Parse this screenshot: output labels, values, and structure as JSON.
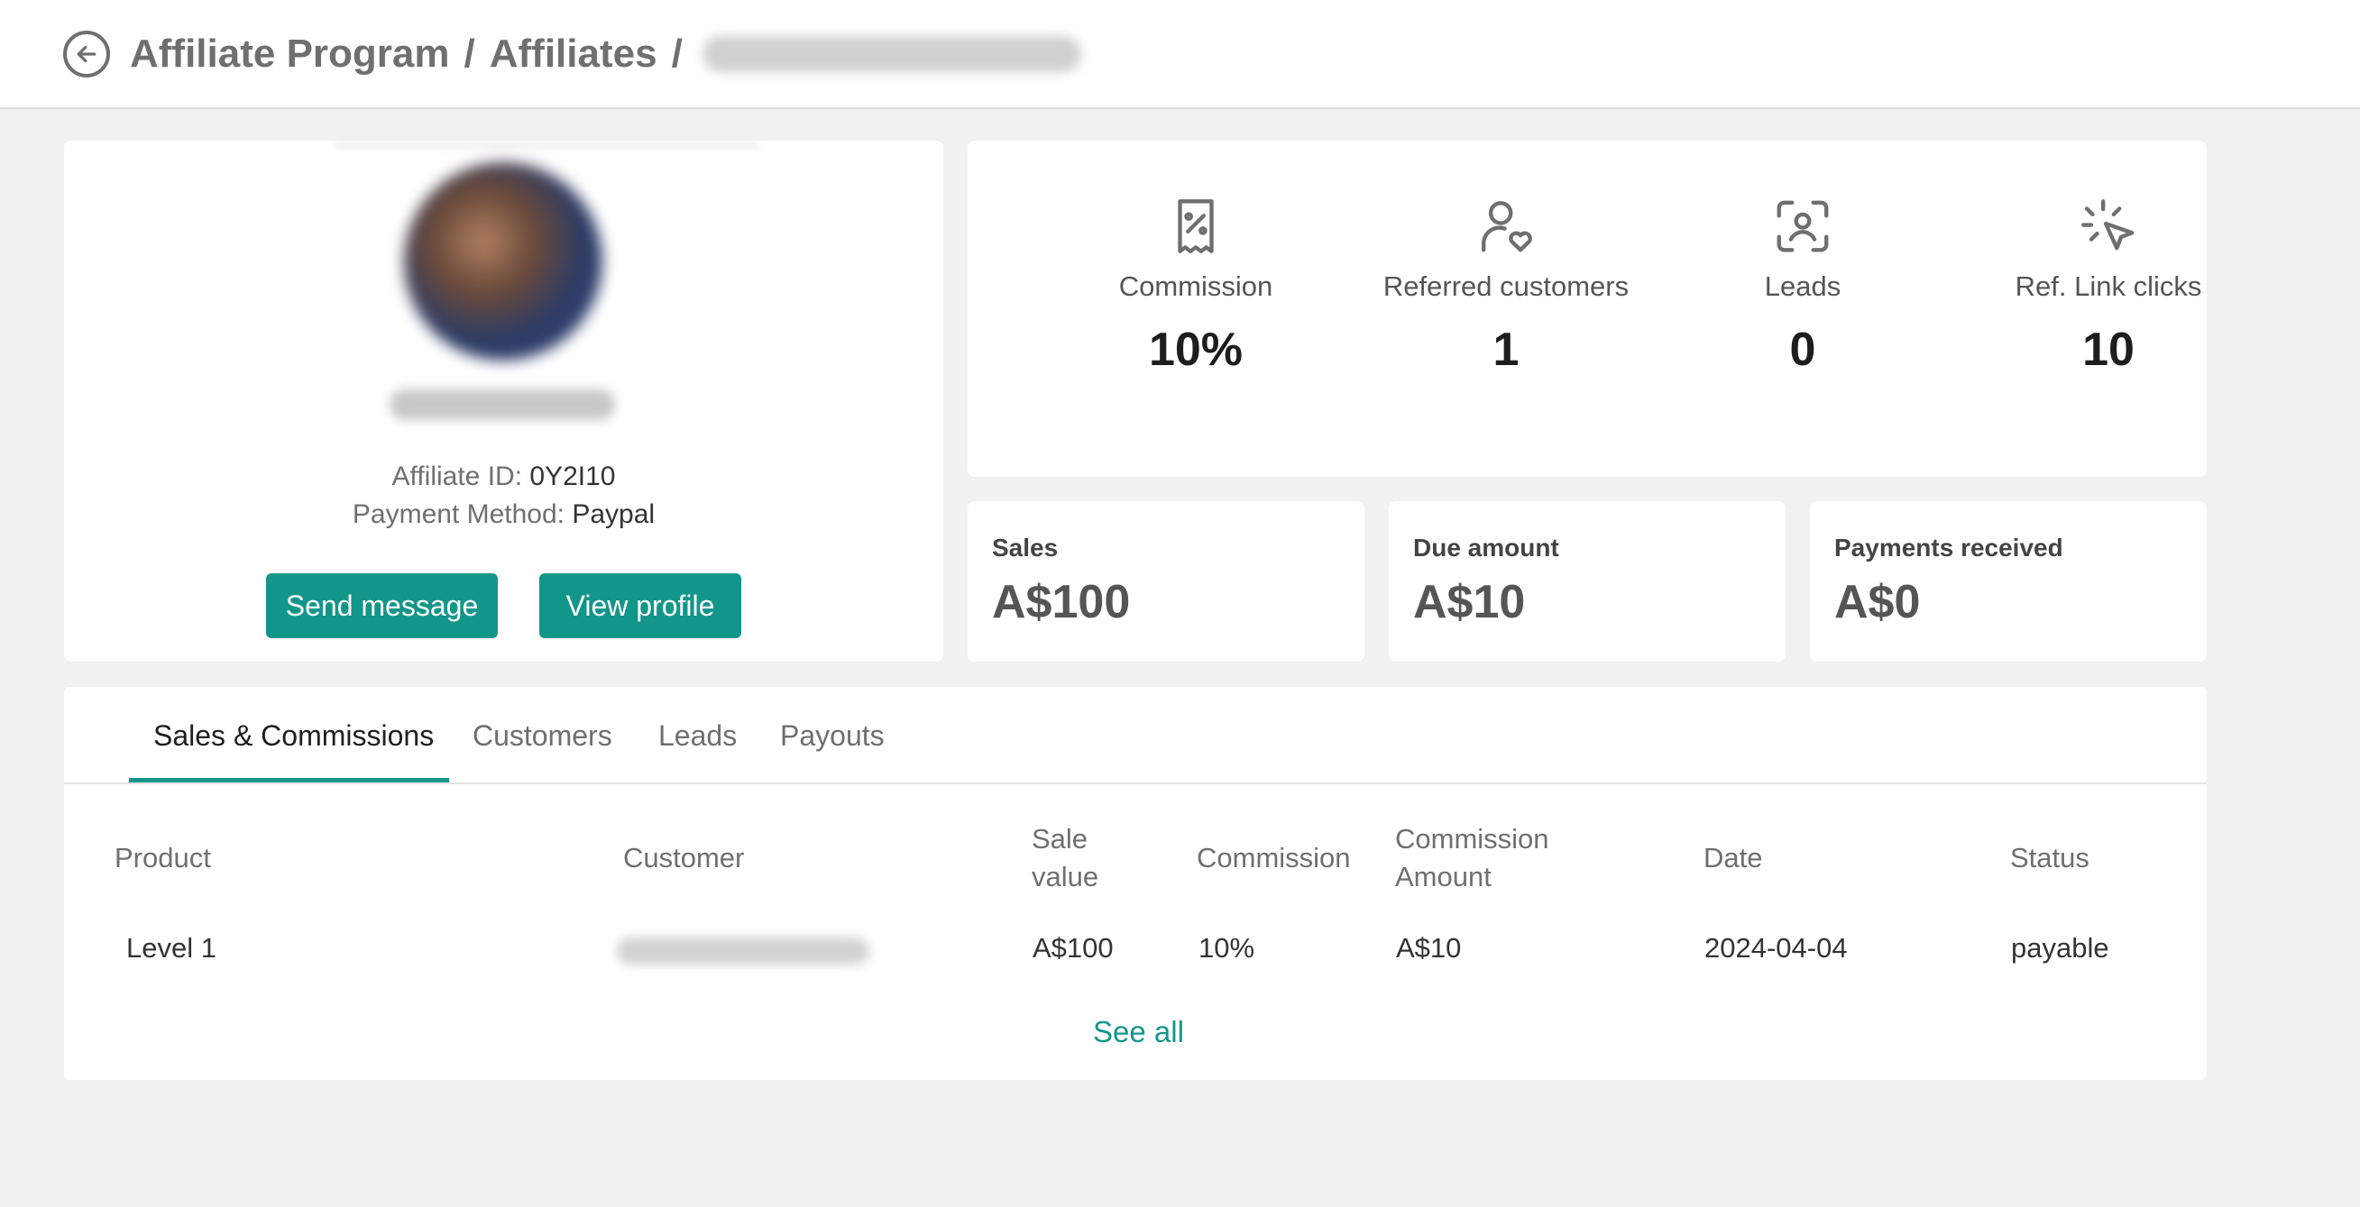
{
  "header": {
    "breadcrumb": [
      "Affiliate Program",
      "Affiliates"
    ],
    "separator": "/"
  },
  "profile": {
    "affiliate_id_label": "Affiliate ID:",
    "affiliate_id": "0Y2I10",
    "payment_method_label": "Payment Method:",
    "payment_method": "Paypal",
    "send_message": "Send message",
    "view_profile": "View profile"
  },
  "stats": [
    {
      "label": "Commission",
      "value": "10%",
      "icon": "receipt-percent-icon"
    },
    {
      "label": "Referred customers",
      "value": "1",
      "icon": "user-heart-icon"
    },
    {
      "label": "Leads",
      "value": "0",
      "icon": "face-scan-icon"
    },
    {
      "label": "Ref. Link clicks",
      "value": "10",
      "icon": "cursor-click-icon"
    }
  ],
  "amounts": [
    {
      "label": "Sales",
      "value": "A$100"
    },
    {
      "label": "Due amount",
      "value": "A$10"
    },
    {
      "label": "Payments received",
      "value": "A$0"
    }
  ],
  "tabs": [
    "Sales & Commissions",
    "Customers",
    "Leads",
    "Payouts"
  ],
  "table": {
    "headers": [
      "Product",
      "Customer",
      "Sale value",
      "Commission",
      "Commission Amount",
      "Date",
      "Status"
    ],
    "rows": [
      {
        "product": "Level 1",
        "sale_value": "A$100",
        "commission": "10%",
        "commission_amount": "A$10",
        "date": "2024-04-04",
        "status": "payable"
      }
    ]
  },
  "see_all": "See all",
  "colors": {
    "accent": "#13968a",
    "background": "#f1f1f1"
  }
}
